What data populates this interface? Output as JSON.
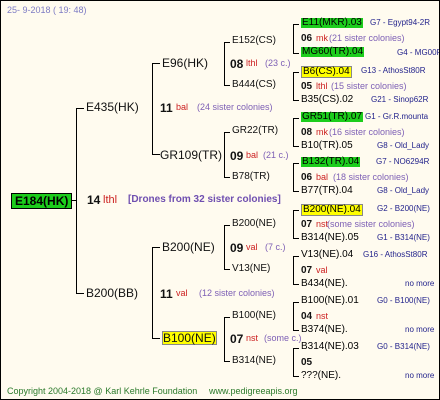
{
  "header": {
    "date_line": "25-  9-2018 (  19:  48)"
  },
  "footer": {
    "copyright": "Copyright 2004-2018 @ Karl Kehrle Foundation",
    "site": "www.pedigreeapis.org"
  },
  "root": {
    "id": "E184(HK)",
    "num": "14",
    "status": "lthl",
    "drones": "[Drones from 32 sister colonies]"
  },
  "gen1": [
    {
      "id": "E435(HK)",
      "num": "11",
      "status": "bal",
      "sisters": "(24 sister colonies)"
    },
    {
      "id": "B200(BB)",
      "num": "11",
      "status": "val",
      "sisters": "(12 sister colonies)"
    }
  ],
  "gen2": [
    {
      "id": "E96(HK)",
      "num": "08",
      "status": "lthl",
      "sisters": "(23 c.)"
    },
    {
      "id": "GR109(TR)",
      "num": "09",
      "status": "bal",
      "sisters": "(21 c.)"
    },
    {
      "id": "B200(NE)",
      "num": "09",
      "status": "val",
      "sisters": "(7 c.)"
    },
    {
      "id": "B100(NE)",
      "num": "07",
      "status": "nst",
      "sisters": "(some c.)"
    }
  ],
  "gen3": [
    {
      "id": "E152(CS)"
    },
    {
      "id": "B444(CS)"
    },
    {
      "id": "GR22(TR)"
    },
    {
      "id": "B78(TR)"
    },
    {
      "id": "B200(NE)"
    },
    {
      "id": "V13(NE)"
    },
    {
      "id": "B100(NE)"
    },
    {
      "id": "B314(NE)"
    }
  ],
  "gen4": [
    {
      "upper": "E11(MKR).03",
      "upper_desc": "G7 - Egypt94-2R",
      "num": "06",
      "status": "mk",
      "sisters": "(21 sister colonies)",
      "lower": "MG60(TR).04",
      "lower_desc": "G4 - MG00R"
    },
    {
      "upper": "B6(CS).04",
      "upper_desc": "G13 - AthosSt80R",
      "num": "05",
      "status": "lthl",
      "sisters": "(15 sister colonies)",
      "lower": "B35(CS).02",
      "lower_desc": "G21 - Sinop62R"
    },
    {
      "upper": "GR51(TR).07",
      "upper_desc": "G1 - Gr.R.mounta",
      "num": "08",
      "status": "mk",
      "sisters": "(16 sister colonies)",
      "lower": "B10(TR).05",
      "lower_desc": "G8 - Old_Lady"
    },
    {
      "upper": "B132(TR).04",
      "upper_desc": "G7 - NO6294R",
      "num": "06",
      "status": "bal",
      "sisters": "(18 sister colonies)",
      "lower": "B77(TR).04",
      "lower_desc": "G8 - Old_Lady"
    },
    {
      "upper": "B200(NE).04",
      "upper_desc": "G2 - B200(NE)",
      "num": "07",
      "status": "nst",
      "sisters": "(some sister colonies)",
      "lower": "B314(NE).05",
      "lower_desc": "G1 - B314(NE)"
    },
    {
      "upper": "V13(NE).04",
      "upper_desc": "G16 - AthosSt80R",
      "num": "07",
      "status": "val",
      "sisters": "",
      "lower": "B434(NE).",
      "lower_desc": "no more"
    },
    {
      "upper": "B100(NE).01",
      "upper_desc": "G0 - B100(NE)",
      "num": "04",
      "status": "nst",
      "sisters": "",
      "lower": "B374(NE).",
      "lower_desc": "no more"
    },
    {
      "upper": "B314(NE).03",
      "upper_desc": "G0 - B314(NE)",
      "num": "05",
      "status": "",
      "sisters": "",
      "lower": "???(NE).",
      "lower_desc": "no more"
    }
  ]
}
